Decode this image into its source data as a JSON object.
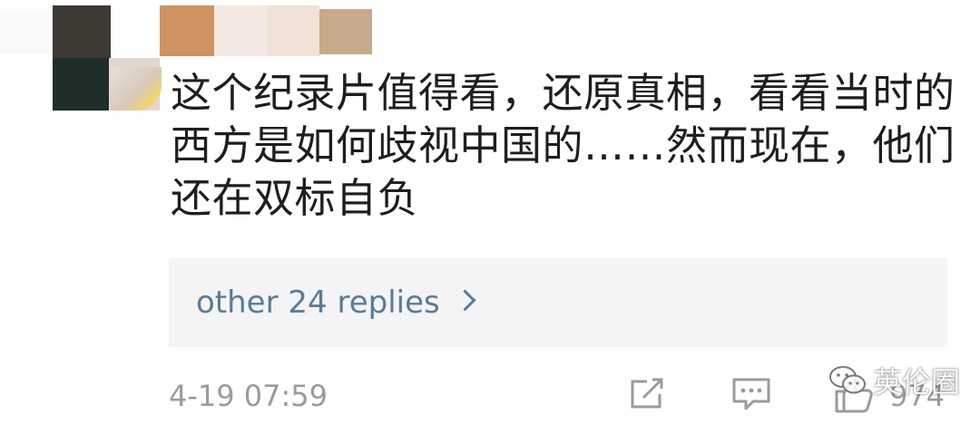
{
  "comment": {
    "lines": [
      "这个纪录片值得看，还原真相，看看当时的",
      "西方是如何歧视中国的……然而现在，他们",
      "还在双标自负"
    ]
  },
  "replies": {
    "label": "other 24 replies"
  },
  "footer": {
    "timestamp": "4-19 07:59",
    "like_count": "974"
  },
  "watermark": {
    "text": "英伦圈"
  },
  "icons": {
    "share": "share-icon",
    "reply": "comment-icon",
    "like": "thumbs-up-icon",
    "chevron": "chevron-right-icon",
    "watermark": "wechat-icon"
  },
  "colors": {
    "text": "#1e1e1e",
    "link": "#5a7b98",
    "meta": "#9b9b9b",
    "reply_bg": "#f4f4f4"
  }
}
